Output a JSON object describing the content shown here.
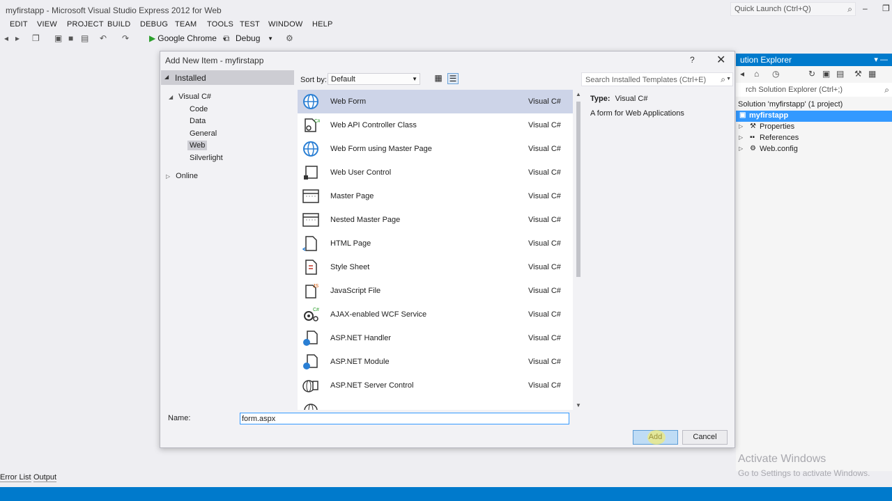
{
  "window": {
    "title": "myfirstapp - Microsoft Visual Studio Express 2012 for Web",
    "quick_launch_placeholder": "Quick Launch (Ctrl+Q)"
  },
  "menu": [
    "EDIT",
    "VIEW",
    "PROJECT",
    "BUILD",
    "DEBUG",
    "TEAM",
    "TOOLS",
    "TEST",
    "WINDOW",
    "HELP"
  ],
  "toolbar": {
    "run_target": "Google Chrome",
    "configuration": "Debug"
  },
  "solution_explorer": {
    "title": "ution Explorer",
    "search_placeholder": "rch Solution Explorer (Ctrl+;)",
    "solution_label": "Solution 'myfirstapp' (1 project)",
    "project": "myfirstapp",
    "items": [
      "Properties",
      "References",
      "Web.config"
    ]
  },
  "bottom_tabs": [
    "Error List",
    "Output"
  ],
  "watermark": {
    "line1": "Activate Windows",
    "line2": "Go to Settings to activate Windows."
  },
  "dialog": {
    "title": "Add New Item - myfirstapp",
    "help": "?",
    "installed_label": "Installed",
    "tree": {
      "root": "Visual C#",
      "children": [
        "Code",
        "Data",
        "General",
        "Web",
        "Silverlight"
      ],
      "selected": "Web",
      "online": "Online"
    },
    "sort_label": "Sort by:",
    "sort_value": "Default",
    "search_placeholder": "Search Installed Templates (Ctrl+E)",
    "templates": [
      {
        "name": "Web Form",
        "lang": "Visual C#",
        "icon": "globe-icon"
      },
      {
        "name": "Web API Controller Class",
        "lang": "Visual C#",
        "icon": "api-controller-icon"
      },
      {
        "name": "Web Form using Master Page",
        "lang": "Visual C#",
        "icon": "globe-icon"
      },
      {
        "name": "Web User Control",
        "lang": "Visual C#",
        "icon": "user-control-icon"
      },
      {
        "name": "Master Page",
        "lang": "Visual C#",
        "icon": "master-page-icon"
      },
      {
        "name": "Nested Master Page",
        "lang": "Visual C#",
        "icon": "master-page-icon"
      },
      {
        "name": "HTML Page",
        "lang": "Visual C#",
        "icon": "html-page-icon"
      },
      {
        "name": "Style Sheet",
        "lang": "Visual C#",
        "icon": "style-sheet-icon"
      },
      {
        "name": "JavaScript File",
        "lang": "Visual C#",
        "icon": "javascript-file-icon"
      },
      {
        "name": "AJAX-enabled WCF Service",
        "lang": "Visual C#",
        "icon": "wcf-service-icon"
      },
      {
        "name": "ASP.NET Handler",
        "lang": "Visual C#",
        "icon": "handler-icon"
      },
      {
        "name": "ASP.NET Module",
        "lang": "Visual C#",
        "icon": "module-icon"
      },
      {
        "name": "ASP.NET Server Control",
        "lang": "Visual C#",
        "icon": "server-control-icon"
      }
    ],
    "selected_index": 0,
    "details": {
      "type_label": "Type:",
      "type_value": "Visual C#",
      "description": "A form for Web Applications"
    },
    "name_label": "Name:",
    "name_value": "form.aspx",
    "add_label": "Add",
    "cancel_label": "Cancel"
  },
  "colors": {
    "accent": "#007acc",
    "selection": "#cdd4e8",
    "project_highlight": "#3399ff"
  }
}
